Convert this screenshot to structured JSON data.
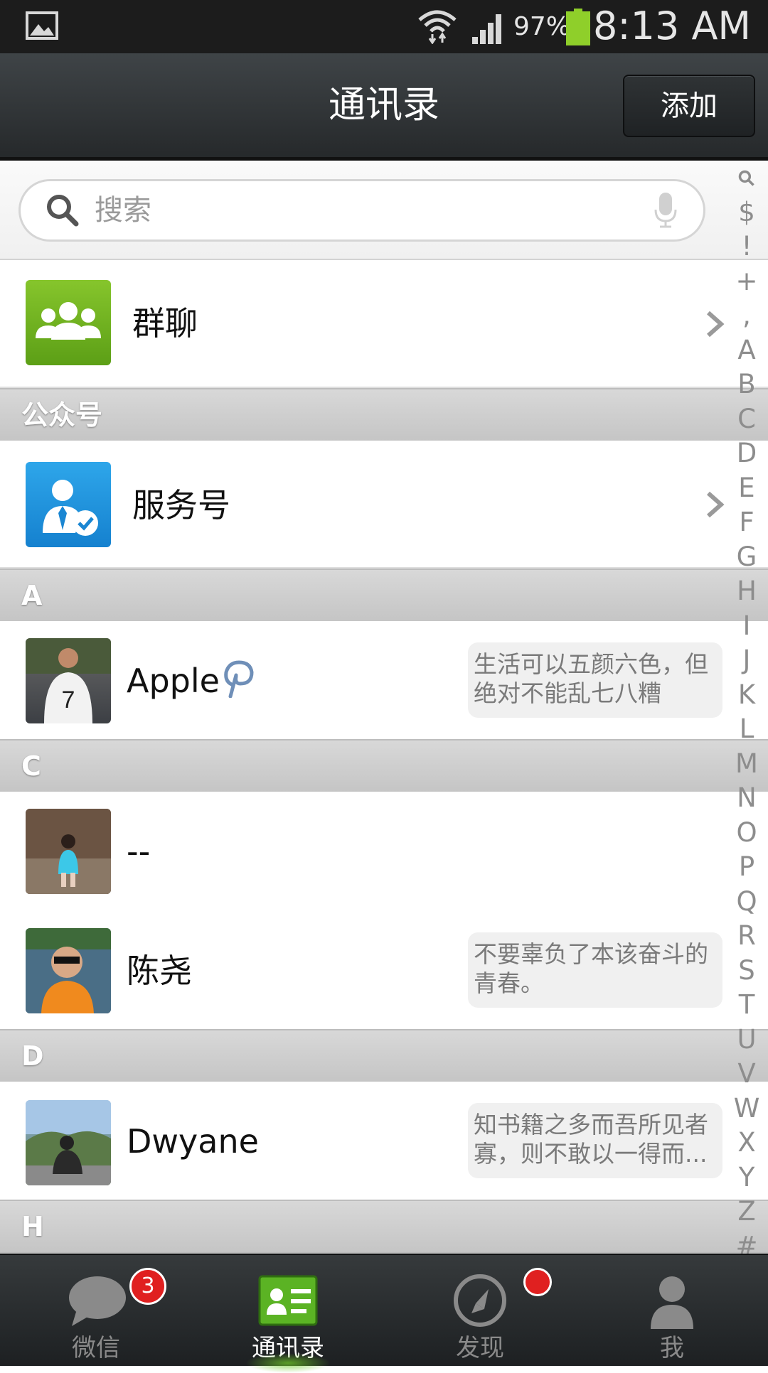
{
  "status_bar": {
    "battery_percent": "97%",
    "time": "8:13 AM",
    "icons": [
      "gallery-icon",
      "wifi-icon",
      "signal-icon",
      "battery-icon"
    ]
  },
  "header": {
    "title": "通讯录",
    "add_button": "添加"
  },
  "search": {
    "placeholder": "搜索"
  },
  "entries": {
    "group_chat": "群聊",
    "official_section": "公众号",
    "service_accounts": "服务号"
  },
  "sections": [
    "A",
    "C",
    "D",
    "H"
  ],
  "contacts": [
    {
      "name": "Apple",
      "signature": "生活可以五颜六色，但绝对不能乱七八糟"
    },
    {
      "name": "--",
      "signature": ""
    },
    {
      "name": "陈尧",
      "signature": "不要辜负了本该奋斗的青春。"
    },
    {
      "name": "Dwyane",
      "signature": "知书籍之多而吾所见者寡，则不敢以一得而..."
    }
  ],
  "index_letters": [
    "Q",
    "$",
    "!",
    "+",
    ",",
    "A",
    "B",
    "C",
    "D",
    "E",
    "F",
    "G",
    "H",
    "I",
    "J",
    "K",
    "L",
    "M",
    "N",
    "O",
    "P",
    "Q",
    "R",
    "S",
    "T",
    "U",
    "V",
    "W",
    "X",
    "Y",
    "Z",
    "#"
  ],
  "tabs": [
    {
      "label": "微信",
      "badge": "3"
    },
    {
      "label": "通讯录"
    },
    {
      "label": "发现"
    },
    {
      "label": "我"
    }
  ],
  "colors": {
    "group_icon_green": "#6fb31e",
    "service_icon_blue": "#1f8fd9",
    "badge_red": "#e02020",
    "active_tab_glow": "#6ec828"
  }
}
